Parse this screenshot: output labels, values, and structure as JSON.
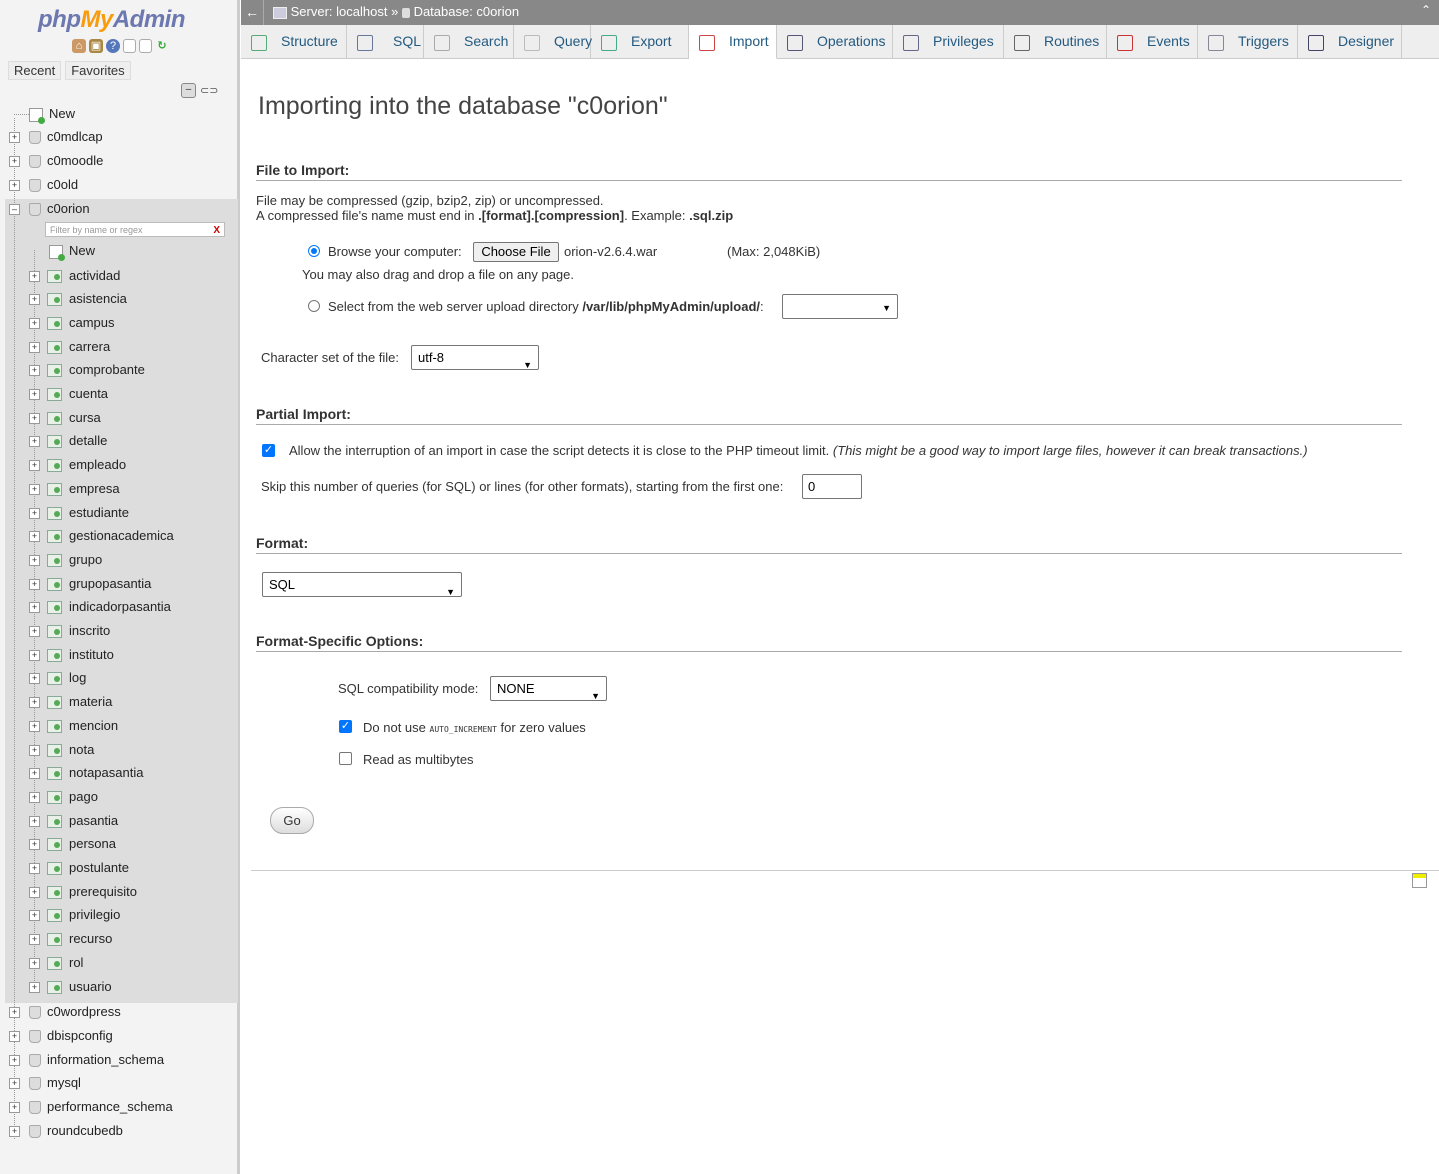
{
  "logo": {
    "part1": "php",
    "part2": "My",
    "part3": "Admin"
  },
  "nav": {
    "tabs": [
      "Recent",
      "Favorites"
    ],
    "new_label": "New",
    "filter_placeholder": "Filter by name or regex",
    "filter_clear": "X",
    "databases_top": [
      "c0mdlcap",
      "c0moodle",
      "c0old"
    ],
    "current_db": "c0orion",
    "tables": [
      "actividad",
      "asistencia",
      "campus",
      "carrera",
      "comprobante",
      "cuenta",
      "cursa",
      "detalle",
      "empleado",
      "empresa",
      "estudiante",
      "gestionacademica",
      "grupo",
      "grupopasantia",
      "indicadorpasantia",
      "inscrito",
      "instituto",
      "log",
      "materia",
      "mencion",
      "nota",
      "notapasantia",
      "pago",
      "pasantia",
      "persona",
      "postulante",
      "prerequisito",
      "privilegio",
      "recurso",
      "rol",
      "usuario"
    ],
    "databases_bottom": [
      "c0wordpress",
      "dbispconfig",
      "information_schema",
      "mysql",
      "performance_schema",
      "roundcubedb"
    ]
  },
  "breadcrumb": {
    "server": "Server: localhost",
    "sep": "»",
    "database": "Database: c0orion"
  },
  "tabs": [
    "Structure",
    "SQL",
    "Search",
    "Query",
    "Export",
    "Import",
    "Operations",
    "Privileges",
    "Routines",
    "Events",
    "Triggers",
    "Designer"
  ],
  "active_tab": "Import",
  "page": {
    "title": "Importing into the database \"c0orion\"",
    "file_section": "File to Import:",
    "compress_note1": "File may be compressed (gzip, bzip2, zip) or uncompressed.",
    "compress_note2a": "A compressed file's name must end in ",
    "compress_note2b": ".[format].[compression]",
    "compress_note2c": ". Example: ",
    "compress_note2d": ".sql.zip",
    "browse_label": "Browse your computer:",
    "choose_file": "Choose File",
    "chosen_file": "orion-v2.6.4.war",
    "max_size": "(Max: 2,048KiB)",
    "drag_note": "You may also drag and drop a file on any page.",
    "upload_dir_label": "Select from the web server upload directory ",
    "upload_dir_path": "/var/lib/phpMyAdmin/upload/",
    "upload_dir_colon": ":",
    "charset_label": "Character set of the file:",
    "charset_value": "utf-8",
    "partial_section": "Partial Import:",
    "interrupt_label": "Allow the interruption of an import in case the script detects it is close to the PHP timeout limit.",
    "interrupt_note": "(This might be a good way to import large files, however it can break transactions.)",
    "skip_label": "Skip this number of queries (for SQL) or lines (for other formats), starting from the first one:",
    "skip_value": "0",
    "format_section": "Format:",
    "format_value": "SQL",
    "options_section": "Format-Specific Options:",
    "compat_label": "SQL compatibility mode:",
    "compat_value": "NONE",
    "noauto_label1": "Do not use ",
    "noauto_code": "AUTO_INCREMENT",
    "noauto_label2": " for zero values",
    "multibyte_label": "Read as multibytes",
    "go": "Go"
  }
}
